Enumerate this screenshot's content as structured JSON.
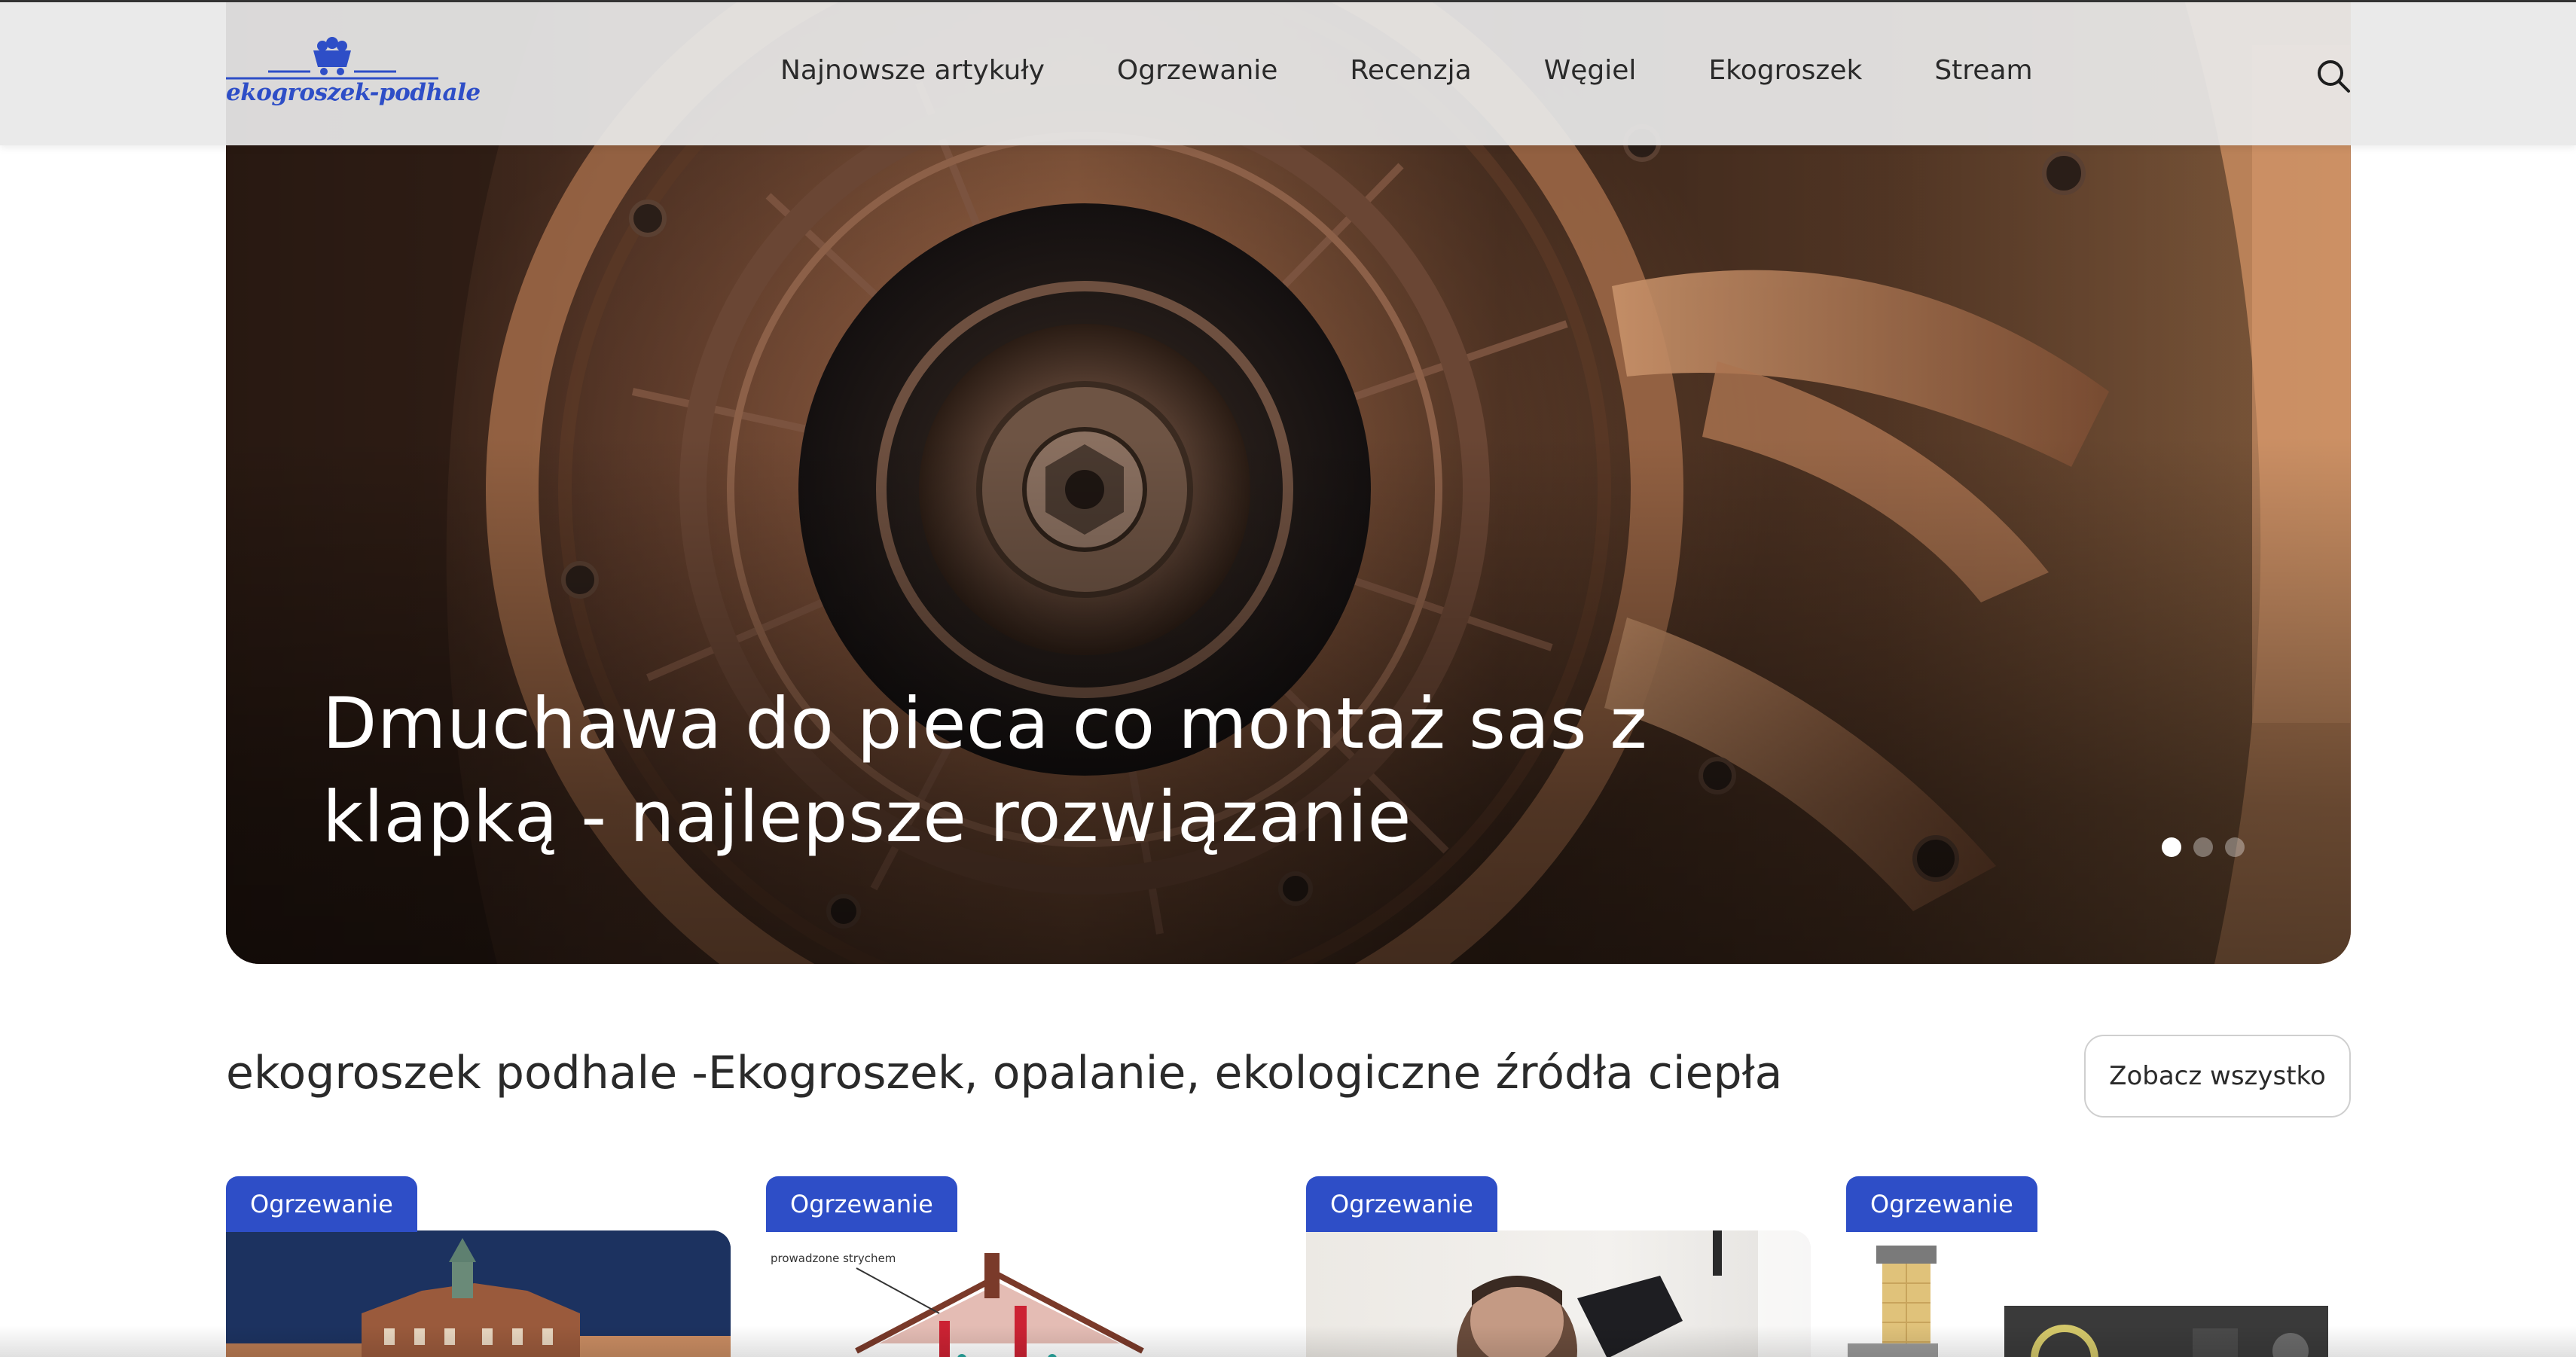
{
  "header": {
    "logo_text": "ekogroszek-podhale",
    "nav": [
      "Najnowsze artykuły",
      "Ogrzewanie",
      "Recenzja",
      "Węgiel",
      "Ekogroszek",
      "Stream"
    ],
    "search_icon": "search-icon"
  },
  "hero": {
    "title": "Dmuchawa do pieca co montaż sas z klapką - najlepsze rozwiązanie",
    "slides_total": 3,
    "active_slide": 1
  },
  "section": {
    "title": "ekogroszek podhale -Ekogroszek, opalanie, ekologiczne źródła ciepła",
    "see_all_label": "Zobacz wszystko"
  },
  "cards": [
    {
      "category": "Ogrzewanie"
    },
    {
      "category": "Ogrzewanie",
      "thumb_caption": "prowadzone strychem"
    },
    {
      "category": "Ogrzewanie"
    },
    {
      "category": "Ogrzewanie"
    }
  ],
  "colors": {
    "brand_blue": "#2e4ec7",
    "header_bg": "#e8e8e8",
    "text_dark": "#2a2a2a"
  }
}
